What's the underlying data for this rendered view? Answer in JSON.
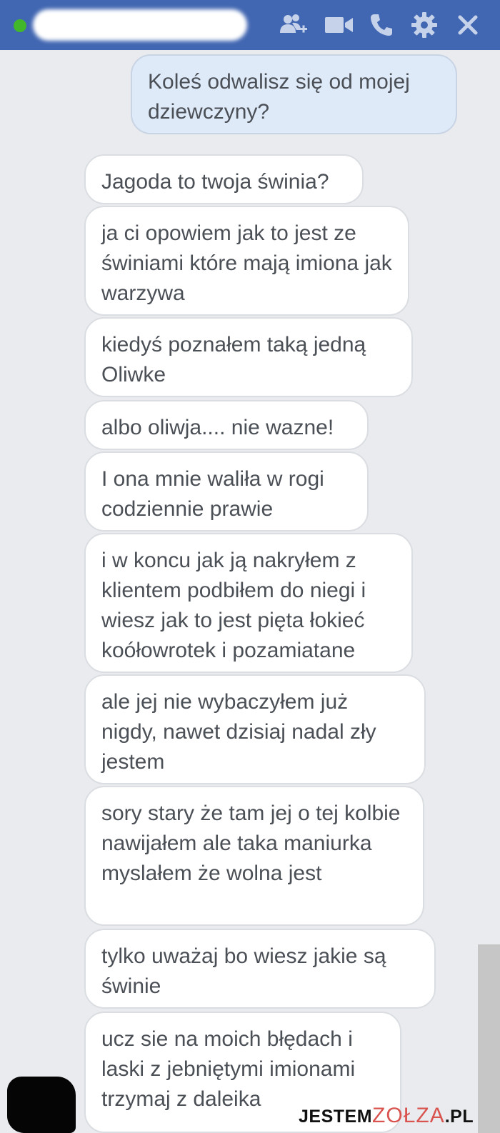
{
  "header": {
    "status": "online",
    "contact_name": "",
    "colors": {
      "bar": "#4267b2",
      "online": "#42b72a"
    },
    "icons": [
      "add-people-icon",
      "video-call-icon",
      "phone-icon",
      "gear-icon",
      "close-icon"
    ]
  },
  "messages": [
    {
      "from": "me",
      "text": "Koleś odwalisz się od mojej dziewczyny?"
    },
    {
      "from": "them",
      "text": "Jagoda to twoja świnia?"
    },
    {
      "from": "them",
      "text": "ja  ci opowiem jak to jest ze świniami które mają imiona jak warzywa"
    },
    {
      "from": "them",
      "text": "kiedyś poznałem taką jedną Oliwke"
    },
    {
      "from": "them",
      "text": "albo oliwja.... nie wazne!"
    },
    {
      "from": "them",
      "text": "I ona mnie waliła w rogi codziennie prawie"
    },
    {
      "from": "them",
      "text": "i w koncu jak ją nakryłem z klientem podbiłem do niegi i wiesz jak to jest pięta łokieć koółowrotek i pozamiatane"
    },
    {
      "from": "them",
      "text": "ale jej nie wybaczyłem już nigdy, nawet dzisiaj nadal zły jestem"
    },
    {
      "from": "them",
      "text": "sory stary że tam jej o tej kolbie nawijałem ale taka maniurka myslałem że wolna jest"
    },
    {
      "from": "them",
      "text": "tylko uważaj bo wiesz jakie są świnie"
    },
    {
      "from": "them",
      "text": "ucz sie na moich błędach i laski z jebniętymi imionami trzymaj z daleika"
    }
  ],
  "watermark": {
    "prefix": "JESTEM",
    "middle": "ZOŁZA",
    "suffix": ".PL"
  }
}
